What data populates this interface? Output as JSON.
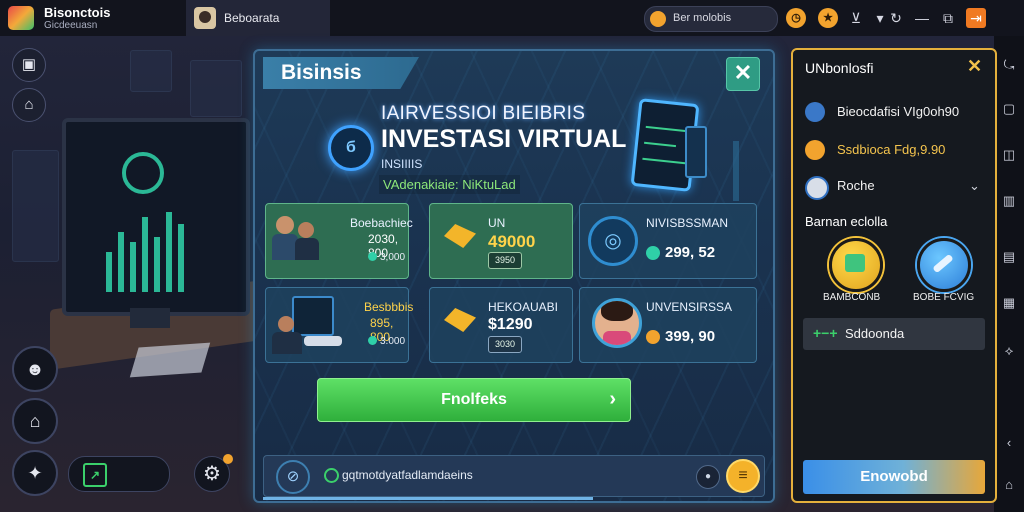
{
  "app": {
    "title": "Bisonctois",
    "subtitle": "Gicdeeuasn",
    "tab_label": "Beboarata"
  },
  "topbar": {
    "coin_label": "Ber molobis",
    "icons": [
      "coin-icon",
      "clock-icon",
      "download-icon",
      "dropdown-icon",
      "refresh-icon",
      "minimize-icon",
      "restore-icon",
      "exit-icon"
    ]
  },
  "dialog": {
    "title": "Bisinsis",
    "hero_top": "IAIRVESSIOI BIEIBRIS",
    "hero_main": "INVESTASI VIRTUAL",
    "hero_small": "INSIIIIS",
    "hero_green": "VAdenakiaie: NiKtuLad",
    "hero_ring": "б",
    "cards": [
      {
        "title": "Boebachiec",
        "value": "2030, 800",
        "sub": "3,000"
      },
      {
        "title": "UN",
        "value": "49000",
        "chip": "3950"
      },
      {
        "title": "NIVISBSSMAN",
        "value": "299, 52"
      },
      {
        "title": "Besbbbis",
        "value": "895, 800",
        "sub": "3.000"
      },
      {
        "title": "HEKOAUABI",
        "value": "$1290",
        "chip": "3030"
      },
      {
        "title": "UNVENSIRSSA",
        "value": "399, 90"
      }
    ],
    "cta_label": "Fnolfeks",
    "cta_arrow": "›",
    "footer_text": "gqtmotdyatfadlamdaeins",
    "footer_dot": "●",
    "footer_coin": "≡"
  },
  "panel": {
    "title": "UNbonlosfi",
    "close": "✕",
    "rows": [
      "Bieocdafisi VIg0oh90",
      "Ssdbioca Fdg,9.90",
      "Roche"
    ],
    "section": "Barnan eclolla",
    "captions": [
      "BAMBCONB",
      "BOBE FCVIG"
    ],
    "field_icon": "+−+",
    "field_label": "Sddoonda",
    "button_label": "Enowobd"
  },
  "colors": {
    "accent_green": "#3bd06b",
    "accent_gold": "#e4b03c",
    "dialog_border": "#3d6d94"
  }
}
